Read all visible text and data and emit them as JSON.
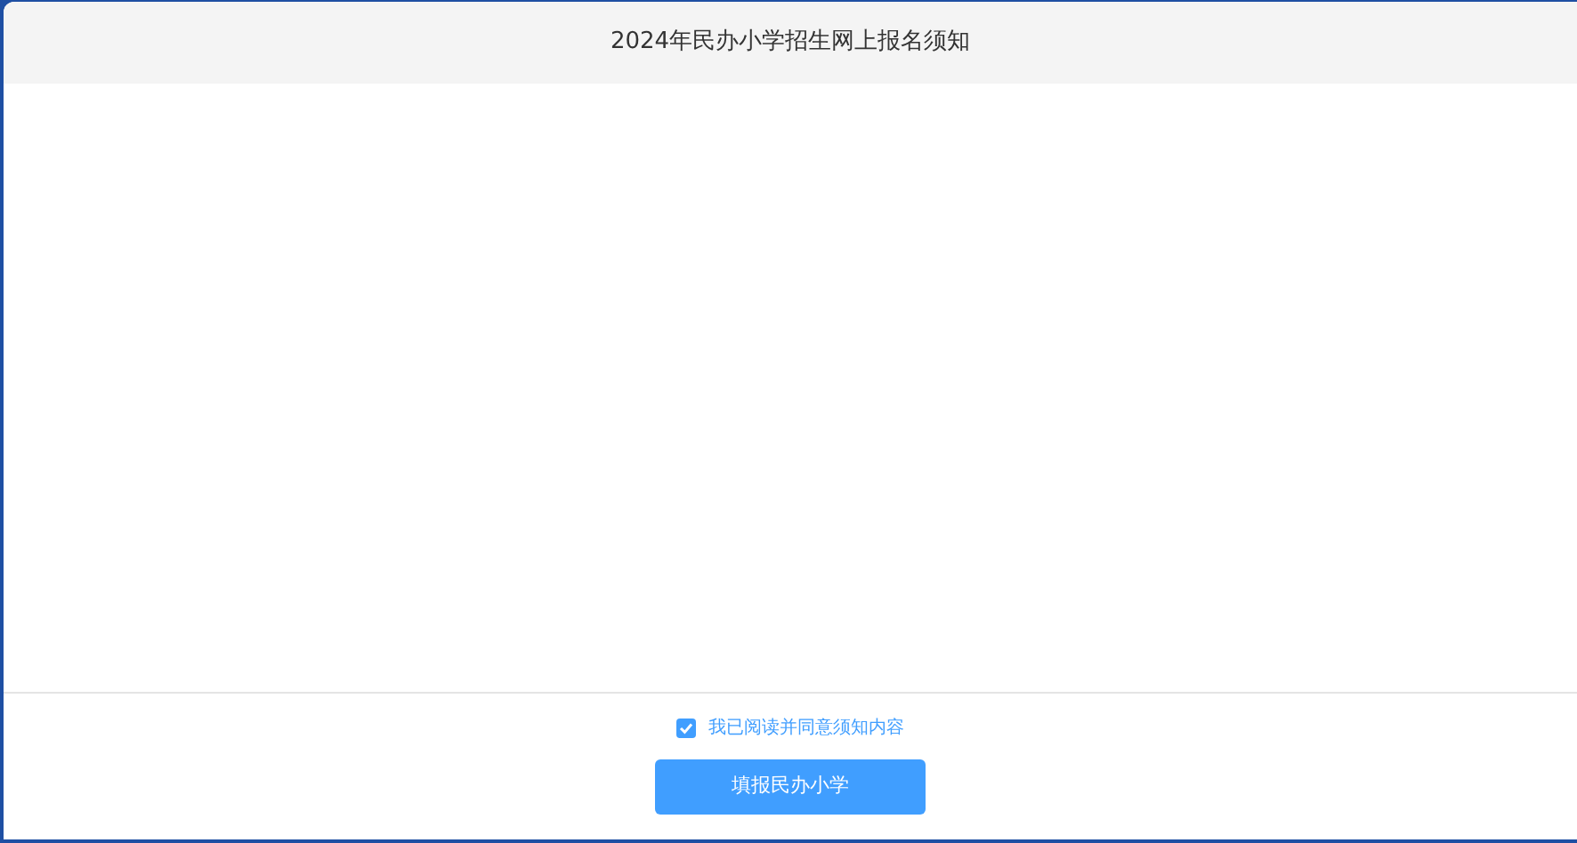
{
  "dialog": {
    "title": "2024年民办小学招生网上报名须知"
  },
  "agreement": {
    "label": "我已阅读并同意须知内容",
    "checked": true
  },
  "buttons": [
    "填报民办小学"
  ]
}
